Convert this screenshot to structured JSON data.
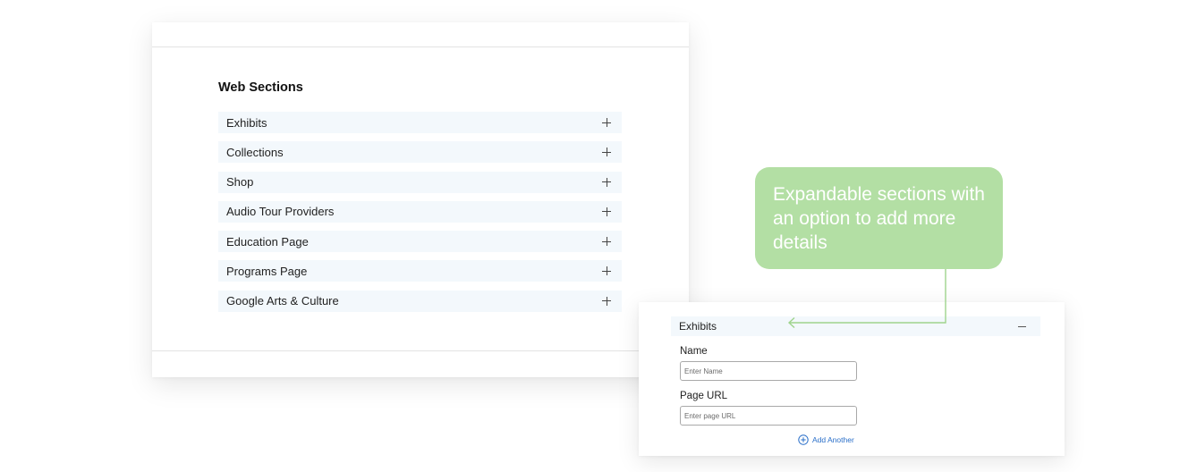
{
  "web_sections": {
    "heading": "Web Sections",
    "items": [
      {
        "label": "Exhibits"
      },
      {
        "label": "Collections"
      },
      {
        "label": "Shop"
      },
      {
        "label": "Audio Tour Providers"
      },
      {
        "label": "Education Page"
      },
      {
        "label": "Programs Page"
      },
      {
        "label": "Google Arts & Culture"
      }
    ]
  },
  "callout": {
    "text": "Expandable sections with an option to add more details",
    "color": "#b3dfa4"
  },
  "expanded_section": {
    "title": "Exhibits",
    "fields": [
      {
        "label": "Name",
        "placeholder": "Enter Name",
        "value": ""
      },
      {
        "label": "Page URL",
        "placeholder": "Enter page URL",
        "value": ""
      }
    ],
    "add_another_label": "Add Another",
    "accent_color": "#2a6fc9"
  },
  "icons": {
    "expand": "plus-icon",
    "collapse": "minus-icon",
    "add": "plus-circle-icon"
  }
}
